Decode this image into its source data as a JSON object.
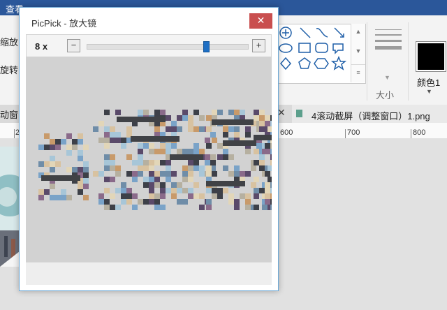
{
  "app": {
    "menu_label": "查看",
    "ribbon_left_1": "缩放",
    "ribbon_left_2": "旋转",
    "size_label": "大小",
    "color_label": "颜色1",
    "tab_left_label": "动窗",
    "tab_title": "4滚动截屏（调整窗口）1.png",
    "ruler": [
      "2",
      "600",
      "700",
      "800"
    ],
    "accent": "#2b579a"
  },
  "magnifier": {
    "title": "PicPick - 放大镜",
    "zoom_label": "8 x",
    "zoom_fraction": 0.75,
    "close_icon": "close-icon",
    "minus_label": "−",
    "plus_label": "+",
    "close_color": "#c94f4f"
  }
}
